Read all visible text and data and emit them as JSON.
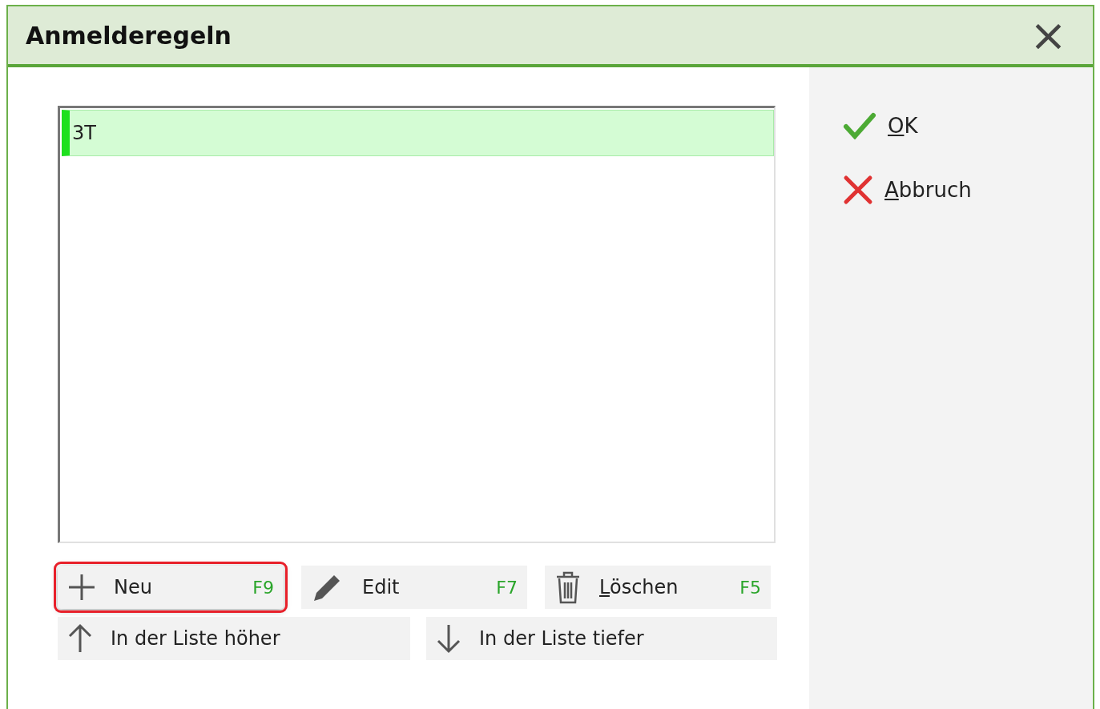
{
  "window": {
    "title": "Anmelderegeln",
    "close": "×"
  },
  "list": {
    "items": [
      {
        "label": "3T",
        "selected": true
      }
    ]
  },
  "buttons": [
    {
      "kind": "plus",
      "label": "Neu",
      "shortcut": "F9",
      "highlighted": true
    },
    {
      "kind": "pencil",
      "label": "Edit",
      "shortcut": "F7",
      "highlighted": false
    },
    {
      "kind": "trash",
      "mnemonic": "L",
      "label": "öschen",
      "shortcut": "F5",
      "highlighted": false
    }
  ],
  "move_buttons": [
    {
      "kind": "up",
      "label": "In der Liste höher"
    },
    {
      "kind": "down",
      "label": "In der Liste tiefer"
    }
  ],
  "actions": [
    {
      "kind": "ok",
      "mnemonic": "O",
      "label": "K"
    },
    {
      "kind": "cancel",
      "mnemonic": "A",
      "label": "bbruch"
    }
  ]
}
